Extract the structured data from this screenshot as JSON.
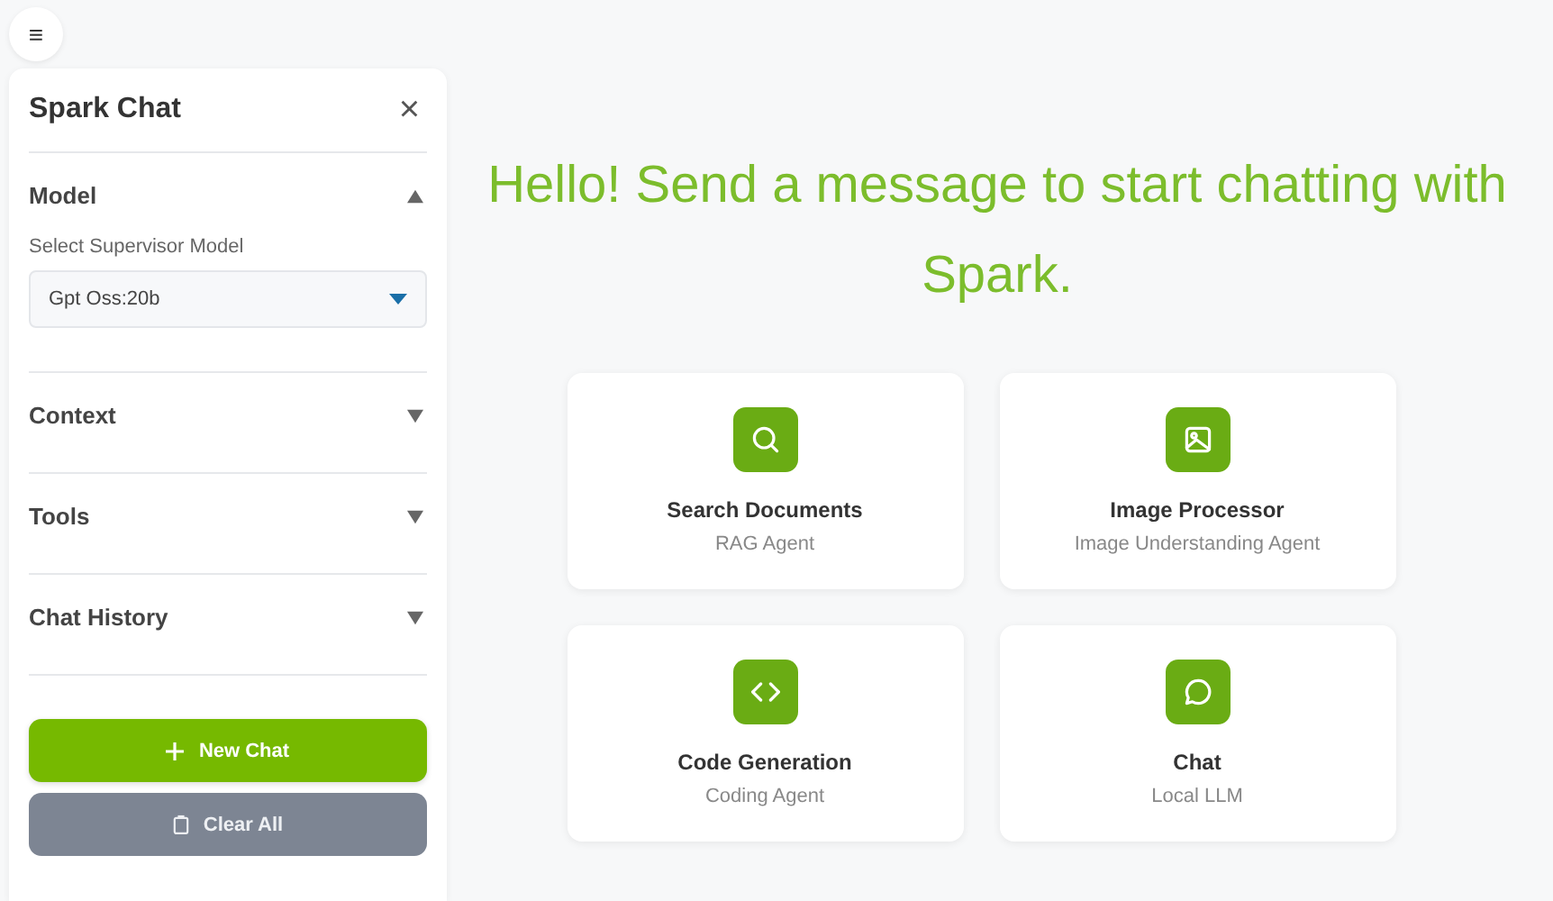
{
  "menu_button": {
    "label": "≡"
  },
  "sidebar": {
    "title": "Spark Chat",
    "close": "×",
    "sections": [
      {
        "title": "Model",
        "expanded": true,
        "field_label": "Select Supervisor Model",
        "select_value": "Gpt Oss:20b"
      },
      {
        "title": "Context",
        "expanded": false
      },
      {
        "title": "Tools",
        "expanded": false
      },
      {
        "title": "Chat History",
        "expanded": false
      }
    ],
    "buttons": [
      {
        "label": "New Chat",
        "kind": "primary",
        "disabled": false
      },
      {
        "label": "Clear All",
        "kind": "clear",
        "disabled": true
      }
    ]
  },
  "greeting": "Hello! Send a message to start chatting with Spark.",
  "cards": [
    {
      "kind": "search",
      "title": "Search Documents",
      "subtitle": "RAG Agent"
    },
    {
      "kind": "image",
      "title": "Image Processor",
      "subtitle": "Image Understanding Agent"
    },
    {
      "kind": "code",
      "title": "Code Generation",
      "subtitle": "Coding Agent"
    },
    {
      "kind": "chat",
      "title": "Chat",
      "subtitle": "Local LLM"
    }
  ]
}
